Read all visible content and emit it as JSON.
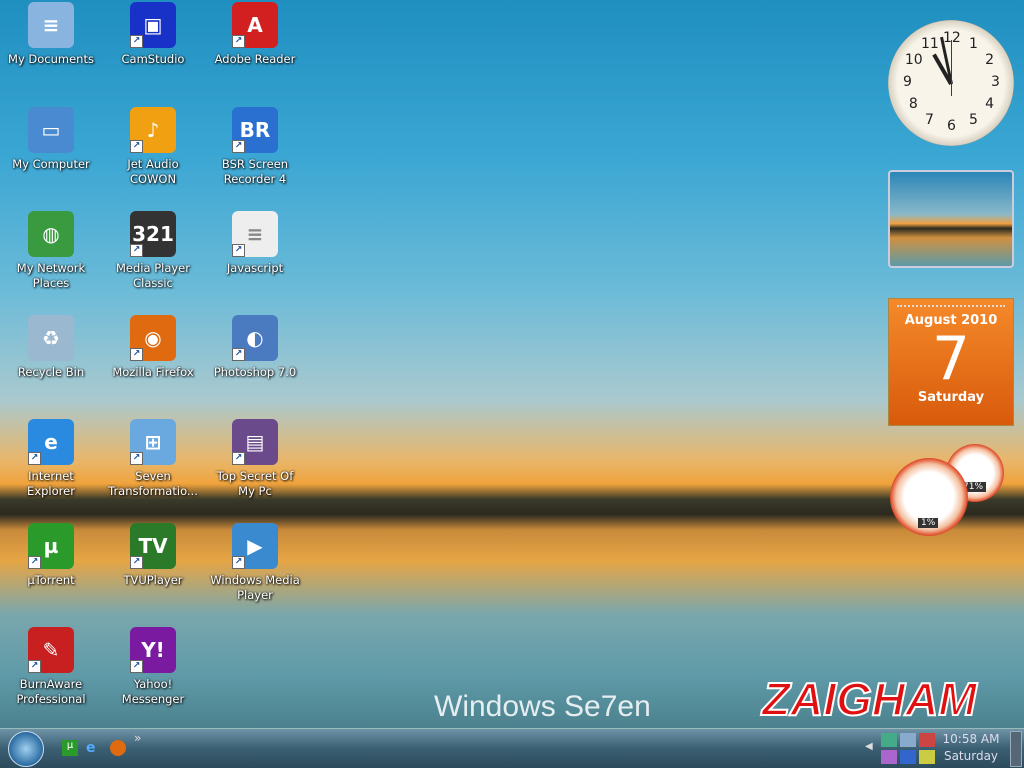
{
  "desktop_icons": [
    {
      "label": "My Documents",
      "color": "#8ab4e0",
      "glyph": "≡"
    },
    {
      "label": "CamStudio",
      "color": "#1832c8",
      "glyph": "▣"
    },
    {
      "label": "Adobe Reader",
      "color": "#d21f1f",
      "glyph": "A"
    },
    {
      "label": "My Computer",
      "color": "#4a8ad0",
      "glyph": "▭"
    },
    {
      "label": "Jet Audio COWON",
      "color": "#f0a010",
      "glyph": "♪"
    },
    {
      "label": "BSR Screen Recorder 4",
      "color": "#2a70d0",
      "glyph": "BR"
    },
    {
      "label": "My Network Places",
      "color": "#3a9a40",
      "glyph": "◍"
    },
    {
      "label": "Media Player Classic",
      "color": "#333333",
      "glyph": "321"
    },
    {
      "label": "Javascript",
      "color": "#eeeeee",
      "glyph": "≡"
    },
    {
      "label": "Recycle Bin",
      "color": "#9ab8d0",
      "glyph": "♻"
    },
    {
      "label": "Mozilla Firefox",
      "color": "#e06a10",
      "glyph": "◉"
    },
    {
      "label": "Photoshop 7.0",
      "color": "#4a7ac0",
      "glyph": "◐"
    },
    {
      "label": "Internet Explorer",
      "color": "#2a8ae0",
      "glyph": "e"
    },
    {
      "label": "Seven Transformatio...",
      "color": "#6aa8e0",
      "glyph": "⊞"
    },
    {
      "label": "Top Secret Of My Pc",
      "color": "#6a4a8a",
      "glyph": "▤"
    },
    {
      "label": "µTorrent",
      "color": "#2a9a2a",
      "glyph": "µ"
    },
    {
      "label": "TVUPlayer",
      "color": "#2a7a2a",
      "glyph": "TV"
    },
    {
      "label": "Windows Media Player",
      "color": "#3a8ad0",
      "glyph": "▶"
    },
    {
      "label": "BurnAware Professional",
      "color": "#c82020",
      "glyph": "✎"
    },
    {
      "label": "Yahoo! Messenger",
      "color": "#7a1aa0",
      "glyph": "Y!"
    }
  ],
  "clock": {
    "numbers": [
      "12",
      "1",
      "2",
      "3",
      "4",
      "5",
      "6",
      "7",
      "8",
      "9",
      "10",
      "11"
    ],
    "time": "10:58"
  },
  "calendar": {
    "month_year": "August 2010",
    "day": "7",
    "weekday": "Saturday"
  },
  "cpu_meter": {
    "cpu_label": "1%",
    "cpu_value": 1,
    "memory_label": "71%",
    "memory_value": 71
  },
  "watermark": {
    "windows": "Windows Se7en",
    "signature": "ZAIGHAM"
  },
  "taskbar": {
    "quick_launch": [
      "µTorrent",
      "Internet Explorer",
      "Firefox"
    ],
    "overflow": "»",
    "time": "10:58 AM",
    "day": "Saturday"
  }
}
